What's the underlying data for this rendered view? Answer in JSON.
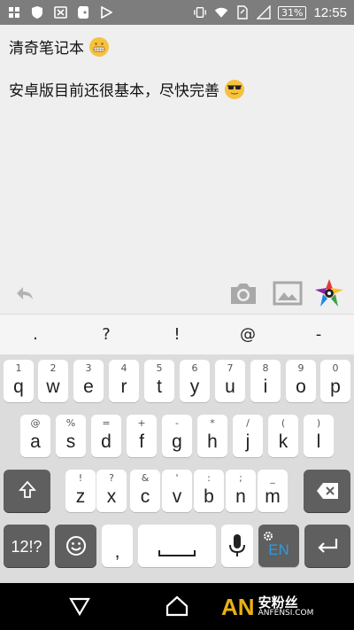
{
  "status_bar": {
    "icons_left": [
      "grid-icon",
      "shield-icon",
      "close-box-icon",
      "evernote-icon",
      "play-icon"
    ],
    "icons_right": [
      "vibrate-icon",
      "wifi-icon",
      "sim-icon",
      "signal-icon"
    ],
    "battery": "31%",
    "time": "12:55"
  },
  "note": {
    "title": "清奇笔记本",
    "body": "安卓版目前还很基本，尽快完善"
  },
  "toolbar": {
    "icons": [
      "reply-icon",
      "camera-icon",
      "image-icon",
      "color-wheel-icon"
    ]
  },
  "keyboard": {
    "suggestions": [
      ".",
      "?",
      "!",
      "@",
      "-"
    ],
    "row1": [
      {
        "m": "q",
        "h": "1"
      },
      {
        "m": "w",
        "h": "2"
      },
      {
        "m": "e",
        "h": "3"
      },
      {
        "m": "r",
        "h": "4"
      },
      {
        "m": "t",
        "h": "5"
      },
      {
        "m": "y",
        "h": "6"
      },
      {
        "m": "u",
        "h": "7"
      },
      {
        "m": "i",
        "h": "8"
      },
      {
        "m": "o",
        "h": "9"
      },
      {
        "m": "p",
        "h": "0"
      }
    ],
    "row2": [
      {
        "m": "a",
        "h": "@"
      },
      {
        "m": "s",
        "h": "%"
      },
      {
        "m": "d",
        "h": "="
      },
      {
        "m": "f",
        "h": "+"
      },
      {
        "m": "g",
        "h": "-"
      },
      {
        "m": "h",
        "h": "*"
      },
      {
        "m": "j",
        "h": "/"
      },
      {
        "m": "k",
        "h": "("
      },
      {
        "m": "l",
        "h": ")"
      }
    ],
    "row3": [
      {
        "m": "z",
        "h": "!"
      },
      {
        "m": "x",
        "h": "?"
      },
      {
        "m": "c",
        "h": "&"
      },
      {
        "m": "v",
        "h": "'"
      },
      {
        "m": "b",
        "h": ":"
      },
      {
        "m": "n",
        "h": ";"
      },
      {
        "m": "m",
        "h": "_"
      }
    ],
    "symbols_label": "12!?",
    "comma": ",",
    "lang_label": "EN"
  },
  "watermark": {
    "logo": "AN",
    "cn": "安粉丝",
    "url": "ANFENSI.COM"
  },
  "colors": {
    "status_bar": "#7d7d7d",
    "keyboard_bg": "#dcdcdc",
    "accent": "#2e9bdf",
    "watermark": "#e9b215"
  }
}
